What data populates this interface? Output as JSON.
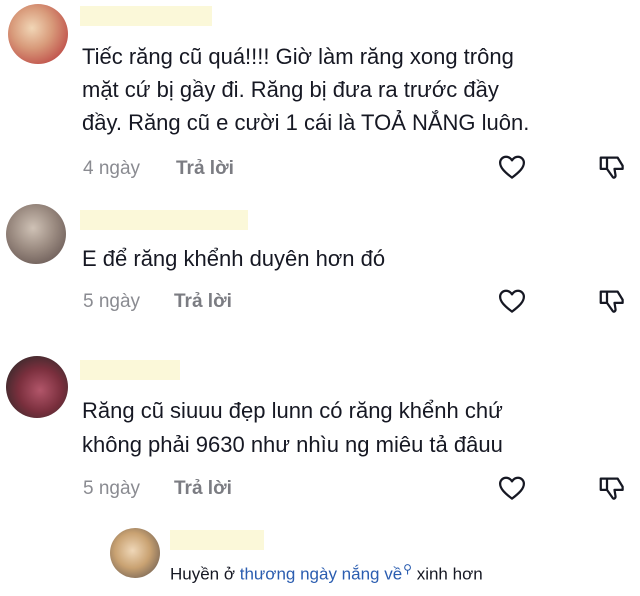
{
  "comments": [
    {
      "lines": [
        "Tiếc răng cũ quá!!!! Giờ làm răng xong trông",
        "mặt cứ bị gầy đi. Răng bị đưa ra trước đầy",
        "đầy. Răng cũ e cười 1 cái là TOẢ NẮNG luôn."
      ],
      "time": "4 ngày",
      "reply_label": "Trả lời"
    },
    {
      "lines": [
        "E để răng khểnh duyên hơn đó"
      ],
      "time": "5 ngày",
      "reply_label": "Trả lời"
    },
    {
      "lines": [
        "Răng cũ siuuu đẹp lunn có răng khểnh chứ",
        "không phải 9630 như nhìu ng miêu tả đâuu"
      ],
      "time": "5 ngày",
      "reply_label": "Trả lời"
    }
  ],
  "reply": {
    "prefix": "Huyền ở",
    "link_text": "thương ngày nắng về",
    "suffix": "xinh hơn"
  },
  "colors": {
    "name_redaction": "#fbf8d9",
    "link": "#2b5db0",
    "muted": "#8a8b91"
  },
  "icons": [
    "heart-outline-icon",
    "dislike-icon",
    "search-icon"
  ]
}
